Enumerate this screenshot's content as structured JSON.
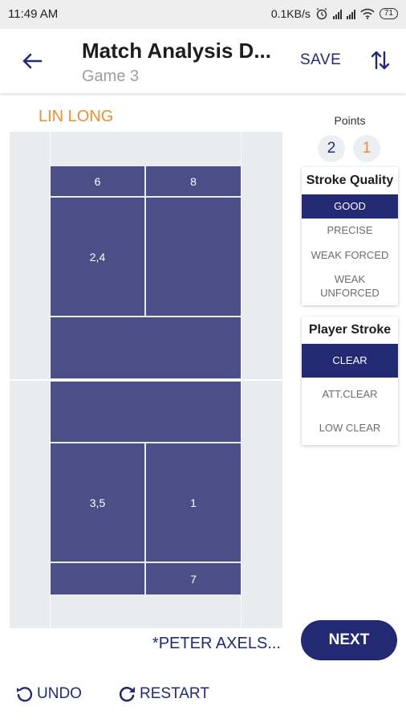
{
  "status_bar": {
    "time": "11:49 AM",
    "network_speed": "0.1KB/s",
    "battery": "71",
    "icons": [
      "alarm-icon",
      "signal-icon",
      "wifi-icon",
      "battery-icon"
    ]
  },
  "header": {
    "title": "Match Analysis D...",
    "subtitle": "Game 3",
    "save_label": "SAVE",
    "back_icon": "arrow-left-icon",
    "sort_icon": "swap-vertical-icon"
  },
  "court": {
    "top_player": "LIN LONG",
    "bottom_player": "*PETER AXELS...",
    "zones": [
      {
        "id": "top-back-left",
        "label": "6"
      },
      {
        "id": "top-back-right",
        "label": "8"
      },
      {
        "id": "top-mid-left",
        "label": "2,4"
      },
      {
        "id": "top-mid-right",
        "label": ""
      },
      {
        "id": "top-front",
        "label": ""
      },
      {
        "id": "bottom-front",
        "label": ""
      },
      {
        "id": "bottom-mid-left",
        "label": "3,5"
      },
      {
        "id": "bottom-mid-right",
        "label": "1"
      },
      {
        "id": "bottom-back-left",
        "label": ""
      },
      {
        "id": "bottom-back-right",
        "label": "7"
      }
    ]
  },
  "points": {
    "label": "Points",
    "values": [
      "2",
      "1"
    ]
  },
  "stroke_quality": {
    "title": "Stroke Quality",
    "options": [
      "GOOD",
      "PRECISE",
      "WEAK FORCED",
      "WEAK UNFORCED"
    ],
    "selected": "GOOD"
  },
  "player_stroke": {
    "title": "Player Stroke",
    "options": [
      "CLEAR",
      "ATT.CLEAR",
      "LOW CLEAR"
    ],
    "selected": "CLEAR"
  },
  "actions": {
    "next": "NEXT",
    "undo": "UNDO",
    "restart": "RESTART"
  },
  "colors": {
    "primary": "#232a73",
    "zone": "#4b4f87",
    "accent": "#f08d30",
    "court_bg": "#e9ecee"
  }
}
